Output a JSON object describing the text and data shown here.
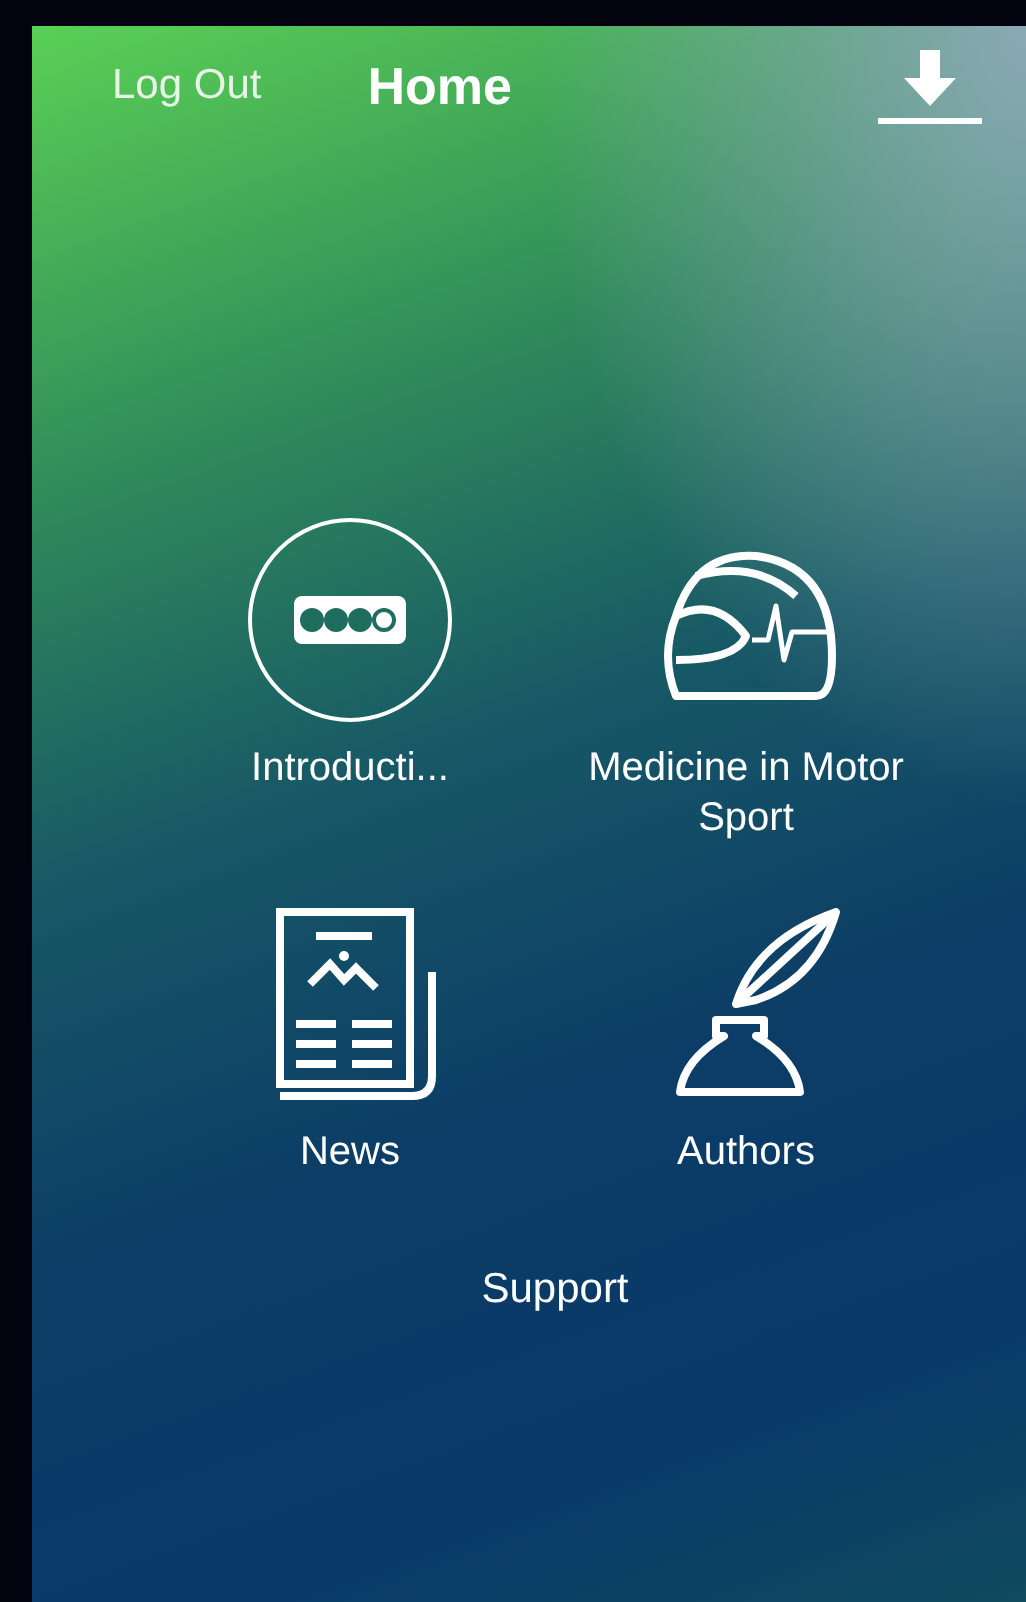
{
  "nav_bar": {
    "left_button": "Log Out",
    "title": "Home"
  },
  "tiles": [
    {
      "kind": "intro",
      "label": "Introducti..."
    },
    {
      "kind": "helmet",
      "label": "Medicine in Motor Sport"
    },
    {
      "kind": "newspaper",
      "label": "News"
    },
    {
      "kind": "quill",
      "label": "Authors"
    }
  ],
  "support_link": "Support"
}
